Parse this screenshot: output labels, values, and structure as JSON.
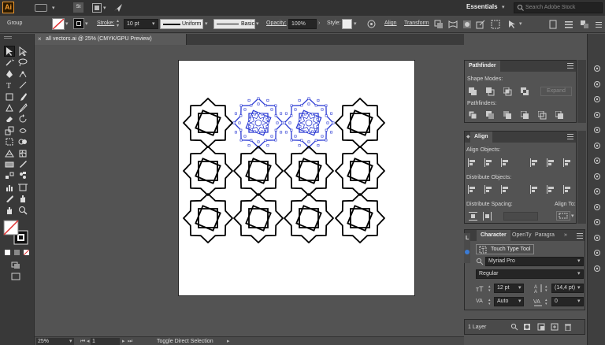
{
  "app": {
    "logo": "Ai",
    "bridge": "St",
    "workspace": "Essentials",
    "search_placeholder": "Search Adobe Stock"
  },
  "control_bar": {
    "selection": "Group",
    "stroke_label": "Stroke:",
    "stroke_value": "10 pt",
    "profile": "Uniform",
    "brush": "Basic",
    "opacity_label": "Opacity:",
    "opacity_value": "100%",
    "style_label": "Style:",
    "align": "Align",
    "transform": "Transform"
  },
  "document": {
    "tab_title": "all vectors.ai @ 25% (CMYK/GPU Preview)",
    "close_glyph": "×"
  },
  "status": {
    "zoom": "25%",
    "artboard": "1",
    "tool_status": "Toggle Direct Selection"
  },
  "pathfinder": {
    "title": "Pathfinder",
    "shape_modes": "Shape Modes:",
    "pathfinders": "Pathfinders:",
    "expand": "Expand"
  },
  "align": {
    "title": "Align",
    "align_objects": "Align Objects:",
    "distribute_objects": "Distribute Objects:",
    "distribute_spacing": "Distribute Spacing:",
    "align_to": "Align To:"
  },
  "character": {
    "tab_character": "Character",
    "tab_opentype": "OpenTy",
    "tab_paragraph": "Paragra",
    "touch_type": "Touch Type Tool",
    "font": "Myriad Pro",
    "style": "Regular",
    "size": "12 pt",
    "leading": "(14,4 pt)",
    "kerning": "Auto",
    "tracking": "0"
  },
  "layers": {
    "count": "1 Layer",
    "peek_label": "L"
  },
  "colors": {
    "selection": "#2d3cd4",
    "ui_dark": "#323232",
    "panel": "#535353",
    "accent_logo": "#f29a2e"
  }
}
